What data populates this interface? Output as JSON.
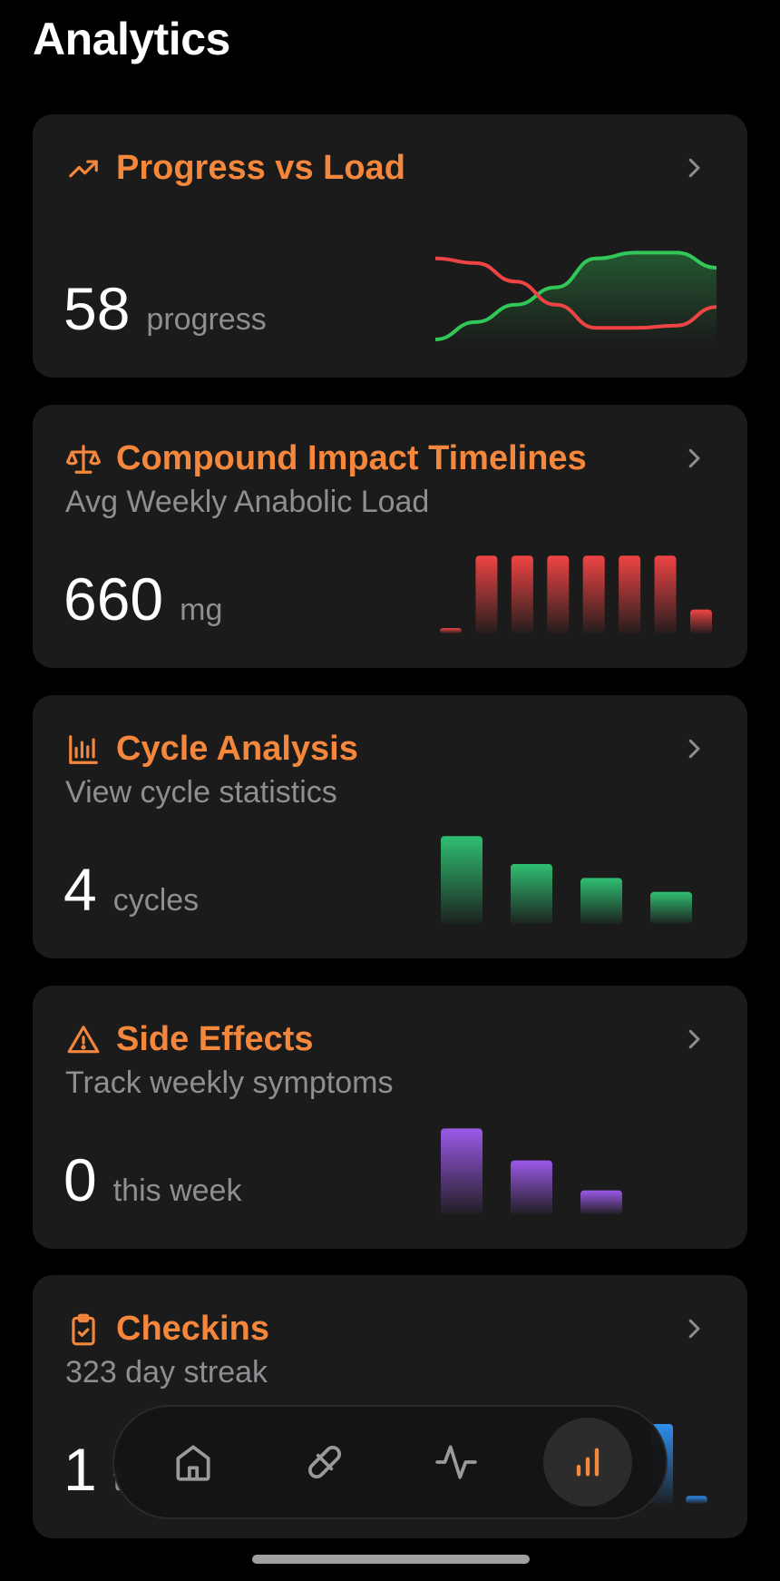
{
  "page": {
    "title": "Analytics"
  },
  "cards": [
    {
      "title": "Progress vs Load",
      "icon": "trending-up-icon",
      "subtitle": "",
      "value": "58",
      "unit": "progress",
      "chart": {
        "type": "line",
        "series": [
          {
            "color": "#32c759",
            "values": [
              0,
              15,
              30,
              45,
              70,
              75,
              75,
              62
            ]
          },
          {
            "color": "#ef4444",
            "values": [
              70,
              66,
              50,
              30,
              10,
              10,
              12,
              28
            ]
          }
        ]
      }
    },
    {
      "title": "Compound Impact Timelines",
      "icon": "scale-icon",
      "subtitle": "Avg Weekly Anabolic Load",
      "value": "660",
      "unit": "mg",
      "chart": {
        "type": "bar",
        "color": "#ef4444",
        "values": [
          5,
          78,
          78,
          78,
          78,
          78,
          78,
          24
        ]
      }
    },
    {
      "title": "Cycle Analysis",
      "icon": "bar-chart-icon",
      "subtitle": "View cycle statistics",
      "value": "4",
      "unit": "cycles",
      "chart": {
        "type": "bar",
        "color": "#2fbf71",
        "values": [
          88,
          60,
          46,
          32
        ]
      }
    },
    {
      "title": "Side Effects",
      "icon": "warning-icon",
      "subtitle": "Track weekly symptoms",
      "value": "0",
      "unit": "this week",
      "chart": {
        "type": "bar",
        "color": "#9b59e8",
        "values": [
          86,
          54,
          24
        ]
      }
    },
    {
      "title": "Checkins",
      "icon": "clipboard-check-icon",
      "subtitle": "323 day streak",
      "value": "1",
      "unit": "t",
      "chart": {
        "type": "bar",
        "color": "#2f8ff0",
        "values": [
          80,
          8
        ]
      }
    }
  ],
  "tabbar": {
    "tabs": [
      {
        "name": "home",
        "icon": "home-icon",
        "active": false
      },
      {
        "name": "compounds",
        "icon": "pill-icon",
        "active": false
      },
      {
        "name": "activity",
        "icon": "pulse-icon",
        "active": false
      },
      {
        "name": "analytics",
        "icon": "analytics-icon",
        "active": true
      }
    ],
    "accent": "#f4873c",
    "inactive_color": "#9a9a9a"
  },
  "colors": {
    "accent": "#f4873c",
    "card_bg": "#1b1b1b"
  }
}
